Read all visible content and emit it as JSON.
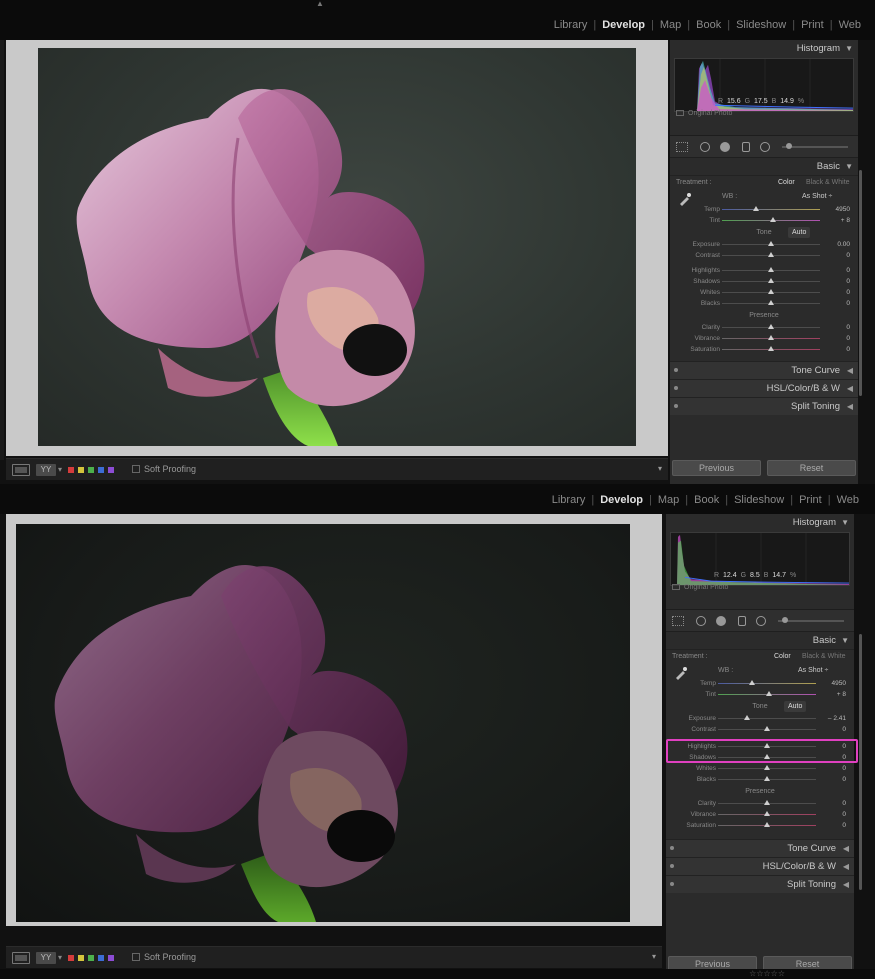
{
  "modules": [
    "Library",
    "Develop",
    "Map",
    "Book",
    "Slideshow",
    "Print",
    "Web"
  ],
  "active_module": "Develop",
  "filmstrip": {
    "soft_proofing": "Soft Proofing",
    "yy_label": "YY",
    "color_labels": [
      "#d43c3c",
      "#d4c43c",
      "#4cb04c",
      "#3c6cd4",
      "#8c4cd4"
    ]
  },
  "panels": {
    "histogram": "Histogram",
    "original_photo": "Original Photo",
    "basic": "Basic",
    "treatment": "Treatment :",
    "color": "Color",
    "black_white": "Black & White",
    "wb": "WB :",
    "wb_value": "As Shot ÷",
    "tone": "Tone",
    "auto": "Auto",
    "presence": "Presence",
    "tone_curve": "Tone Curve",
    "hsl": "HSL",
    "hsl_color": "Color",
    "hsl_bw": "B & W",
    "split_toning": "Split Toning",
    "previous": "Previous",
    "reset": "Reset"
  },
  "before": {
    "rgb": {
      "r": "15.6",
      "g": "17.5",
      "b": "14.9",
      "unit": "%"
    },
    "sliders": {
      "temp": {
        "label": "Temp",
        "value": "4950",
        "pos": 0.35
      },
      "tint": {
        "label": "Tint",
        "value": "+ 8",
        "pos": 0.52
      },
      "exposure": {
        "label": "Exposure",
        "value": "0.00",
        "pos": 0.5
      },
      "contrast": {
        "label": "Contrast",
        "value": "0",
        "pos": 0.5
      },
      "highlights": {
        "label": "Highlights",
        "value": "0",
        "pos": 0.5
      },
      "shadows": {
        "label": "Shadows",
        "value": "0",
        "pos": 0.5
      },
      "whites": {
        "label": "Whites",
        "value": "0",
        "pos": 0.5
      },
      "blacks": {
        "label": "Blacks",
        "value": "0",
        "pos": 0.5
      },
      "clarity": {
        "label": "Clarity",
        "value": "0",
        "pos": 0.5
      },
      "vibrance": {
        "label": "Vibrance",
        "value": "0",
        "pos": 0.5
      },
      "saturation": {
        "label": "Saturation",
        "value": "0",
        "pos": 0.5
      }
    }
  },
  "after": {
    "rgb": {
      "r": "12.4",
      "g": "8.5",
      "b": "14.7",
      "unit": "%"
    },
    "sliders": {
      "temp": {
        "label": "Temp",
        "value": "4950",
        "pos": 0.35
      },
      "tint": {
        "label": "Tint",
        "value": "+ 8",
        "pos": 0.52
      },
      "exposure": {
        "label": "Exposure",
        "value": "– 2.41",
        "pos": 0.3
      },
      "contrast": {
        "label": "Contrast",
        "value": "0",
        "pos": 0.5
      },
      "highlights": {
        "label": "Highlights",
        "value": "0",
        "pos": 0.5
      },
      "shadows": {
        "label": "Shadows",
        "value": "0",
        "pos": 0.5
      },
      "whites": {
        "label": "Whites",
        "value": "0",
        "pos": 0.5
      },
      "blacks": {
        "label": "Blacks",
        "value": "0",
        "pos": 0.5
      },
      "clarity": {
        "label": "Clarity",
        "value": "0",
        "pos": 0.5
      },
      "vibrance": {
        "label": "Vibrance",
        "value": "0",
        "pos": 0.5
      },
      "saturation": {
        "label": "Saturation",
        "value": "0",
        "pos": 0.5
      }
    }
  },
  "colors": {
    "highlight": "#e040c0",
    "flower": "#b06a9a",
    "stem": "#7ccf3a"
  },
  "icons": [
    "eyedropper-icon",
    "crop-grid-icon",
    "spot-removal-icon",
    "red-eye-icon",
    "graduated-filter-icon",
    "radial-filter-icon",
    "adjustment-brush-icon",
    "loupe-view-icon",
    "panel-collapse-icon"
  ]
}
